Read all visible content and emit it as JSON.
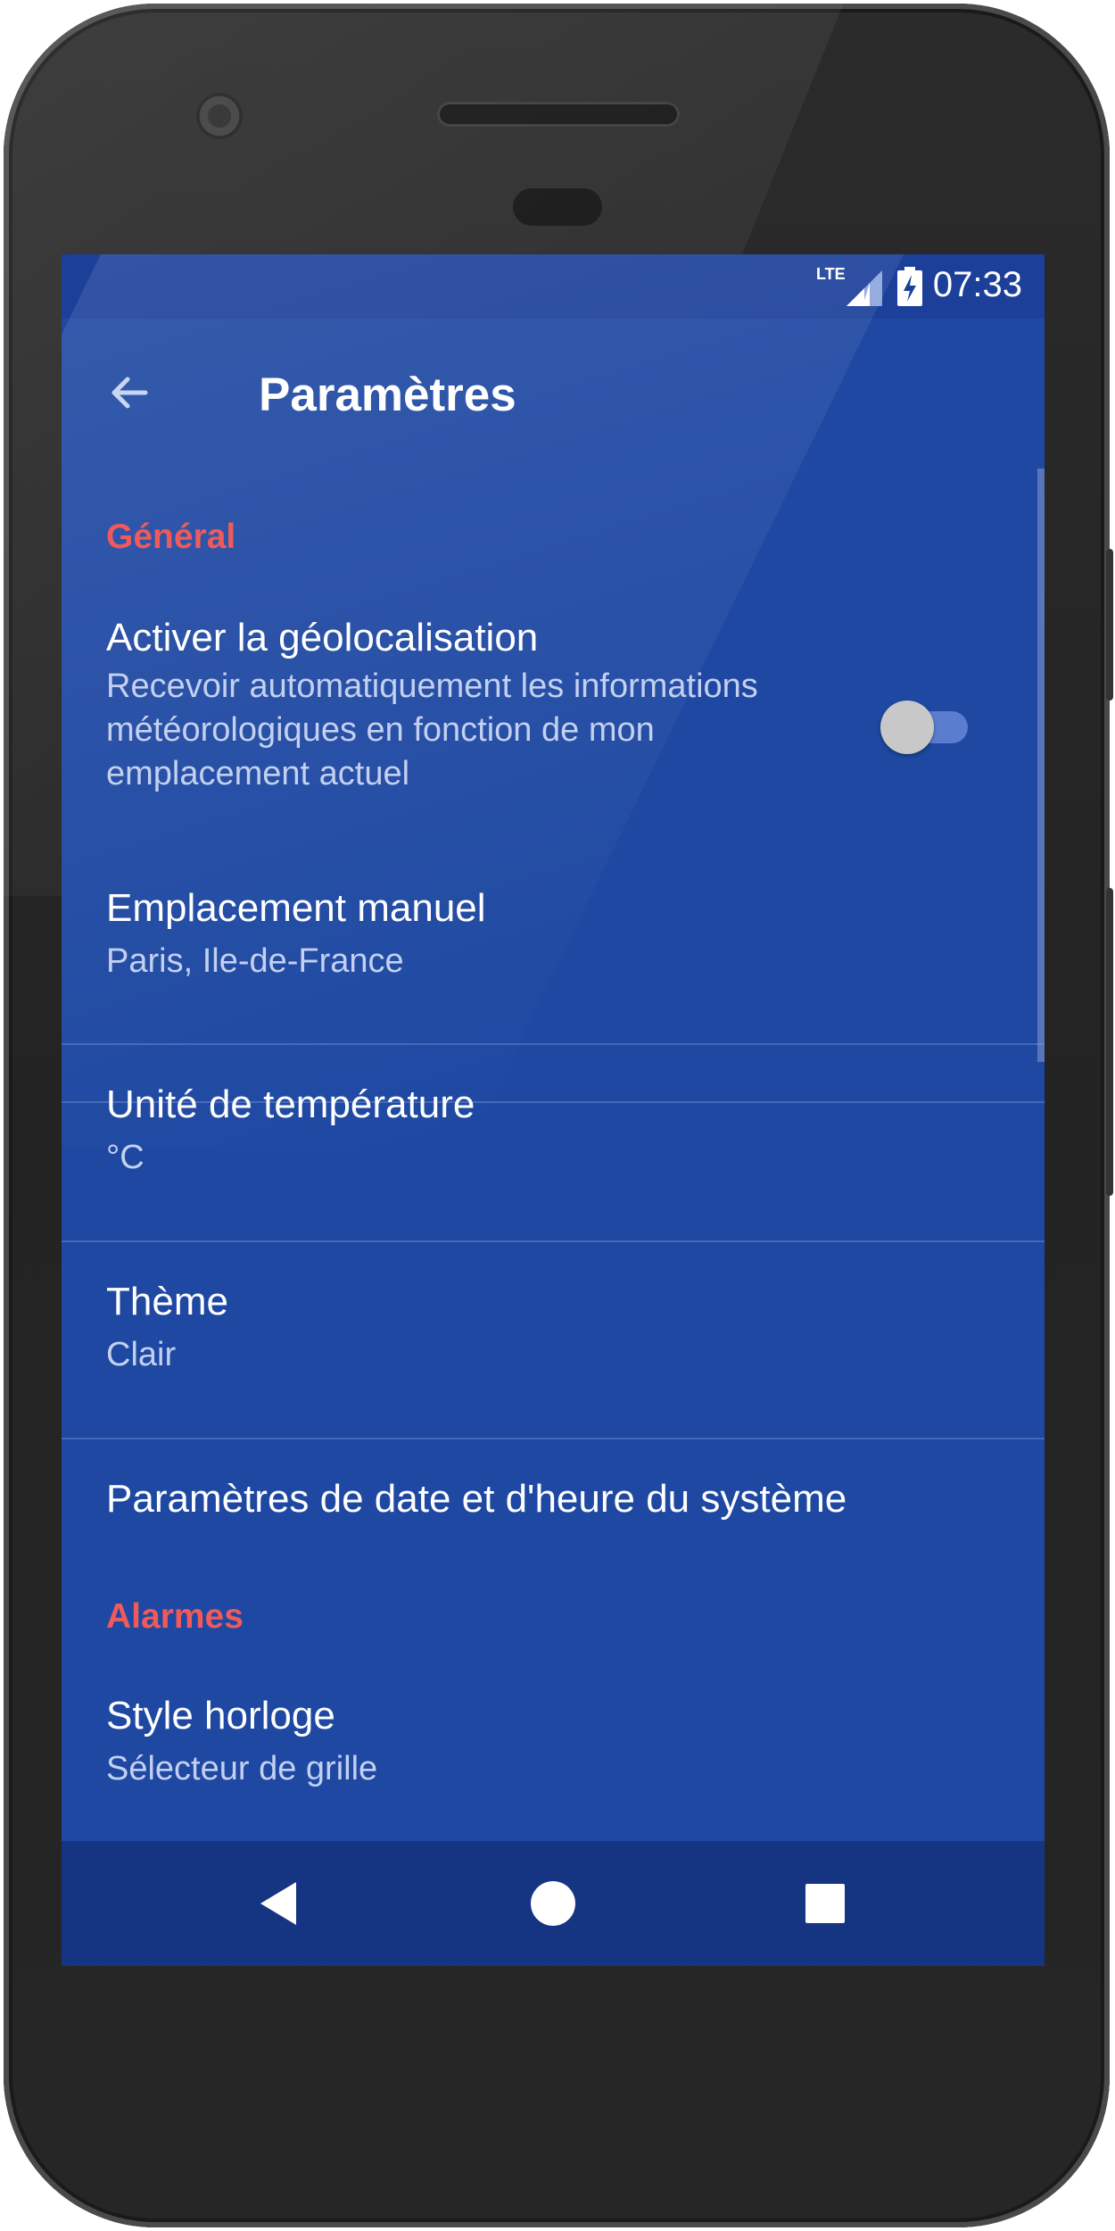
{
  "statusbar": {
    "network_label": "LTE",
    "time": "07:33"
  },
  "appbar": {
    "title": "Paramètres"
  },
  "sections": {
    "general_header": "Général",
    "alarms_header": "Alarmes"
  },
  "prefs": {
    "geolocation": {
      "title": "Activer la géolocalisation",
      "summary": "Recevoir automatiquement les informations météorologiques en fonction de mon emplacement actuel",
      "enabled": false
    },
    "manual_location": {
      "title": "Emplacement manuel",
      "summary": "Paris, Ile-de-France"
    },
    "temperature_unit": {
      "title": "Unité de température",
      "summary": "°C"
    },
    "theme": {
      "title": "Thème",
      "summary": "Clair"
    },
    "system_datetime": {
      "title": "Paramètres de date et d'heure du système"
    },
    "clock_style": {
      "title": "Style horloge",
      "summary": "Sélecteur de grille"
    }
  },
  "icons": {
    "back": "arrow-back-icon",
    "nav_back": "triangle-back-icon",
    "nav_home": "circle-home-icon",
    "nav_recents": "square-recents-icon"
  },
  "colors": {
    "screen_background": "#1e48a2",
    "accent": "#ef5a5a",
    "navbar": "#153582"
  }
}
